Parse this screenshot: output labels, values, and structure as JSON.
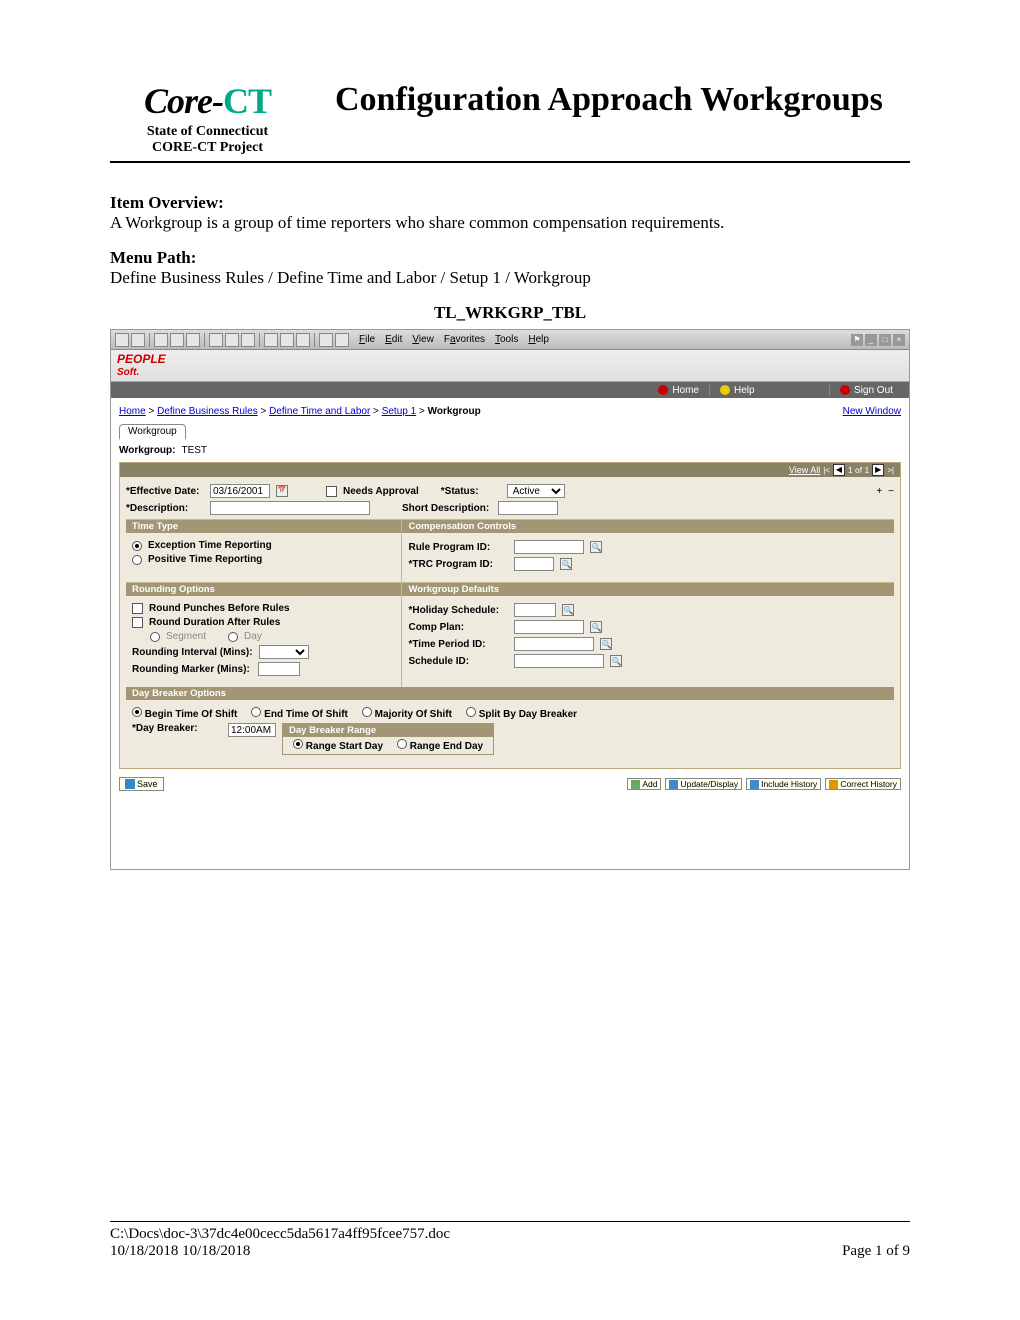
{
  "header": {
    "logo_text": "Core-",
    "logo_ct": "CT",
    "sub1": "State of Connecticut",
    "sub2": "CORE-CT Project",
    "title": "Configuration Approach Workgroups"
  },
  "overview": {
    "label": "Item Overview:",
    "text": "A Workgroup is a group of time reporters who share common compensation requirements."
  },
  "menu_path": {
    "label": "Menu Path:",
    "text": "Define Business Rules / Define Time and Labor / Setup 1 / Workgroup"
  },
  "table_name": "TL_WRKGRP_TBL",
  "screenshot": {
    "menu": {
      "file": "File",
      "edit": "Edit",
      "view": "View",
      "favorites": "Favorites",
      "tools": "Tools",
      "help": "Help"
    },
    "navbar": {
      "home": "Home",
      "help": "Help",
      "signout": "Sign Out"
    },
    "breadcrumb": {
      "home": "Home",
      "b1": "Define Business Rules",
      "b2": "Define Time and Labor",
      "b3": "Setup 1",
      "cur": "Workgroup",
      "new_window": "New Window"
    },
    "tab": "Workgroup",
    "wg_label": "Workgroup:",
    "wg_value": "TEST",
    "panel_hdr": {
      "view_all": "View All",
      "counter": "1 of 1"
    },
    "effdt_label": "*Effective Date:",
    "effdt_value": "03/16/2001",
    "needs_approval": "Needs Approval",
    "status_label": "*Status:",
    "status_value": "Active",
    "desc_label": "*Description:",
    "shortdesc_label": "Short Description:",
    "time_type": {
      "hdr": "Time Type",
      "opt1": "Exception Time Reporting",
      "opt2": "Positive Time Reporting"
    },
    "comp_controls": {
      "hdr": "Compensation Controls",
      "rule": "Rule Program ID:",
      "trc": "*TRC Program ID:"
    },
    "rounding": {
      "hdr": "Rounding Options",
      "opt1": "Round Punches Before Rules",
      "opt2": "Round Duration After Rules",
      "seg": "Segment",
      "day": "Day",
      "interval": "Rounding Interval (Mins):",
      "marker": "Rounding Marker (Mins):"
    },
    "defaults": {
      "hdr": "Workgroup Defaults",
      "hol": "*Holiday Schedule:",
      "comp": "Comp Plan:",
      "tp": "*Time Period ID:",
      "sched": "Schedule ID:"
    },
    "daybreak": {
      "hdr": "Day Breaker Options",
      "o1": "Begin Time Of Shift",
      "o2": "End Time Of Shift",
      "o3": "Majority Of Shift",
      "o4": "Split By Day Breaker",
      "lbl": "*Day Breaker:",
      "val": "12:00AM",
      "range_hdr": "Day Breaker Range",
      "r1": "Range Start Day",
      "r2": "Range End Day"
    },
    "buttons": {
      "save": "Save",
      "add": "Add",
      "upd": "Update/Display",
      "inc": "Include History",
      "cor": "Correct History"
    }
  },
  "footer": {
    "path": "C:\\Docs\\doc-3\\37dc4e00cecc5da5617a4ff95fcee757.doc",
    "dates": "10/18/2018 10/18/2018",
    "page": "Page 1 of 9"
  }
}
